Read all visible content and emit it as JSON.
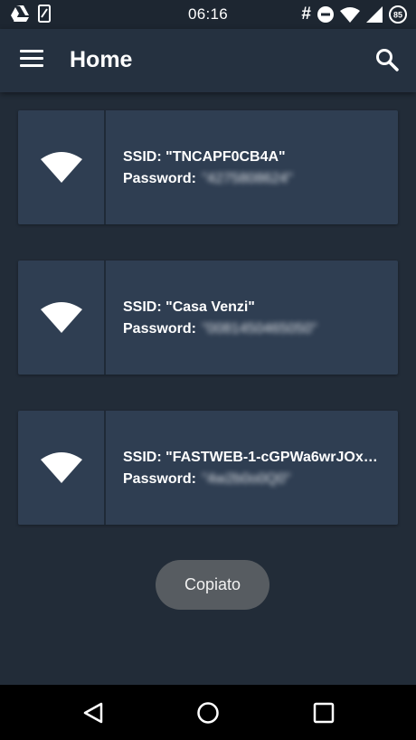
{
  "status_bar": {
    "time": "06:16",
    "left_icons": [
      "drive-icon",
      "phone-icon"
    ],
    "right_icons": [
      "hash-icon",
      "dnd-icon",
      "wifi-icon",
      "signal-icon",
      "battery-icon"
    ],
    "hash_symbol": "#",
    "battery_level": "85"
  },
  "app_bar": {
    "title": "Home",
    "menu_icon": "menu-icon",
    "search_icon": "search-icon"
  },
  "networks": [
    {
      "ssid_label": "SSID: \"TNCAPF0CB4A\"",
      "password_prefix": "Password:",
      "password_hidden": "\"4275808624\""
    },
    {
      "ssid_label": "SSID: \"Casa Venzi\"",
      "password_prefix": "Password:",
      "password_hidden": "\"0081450465050\""
    },
    {
      "ssid_label": "SSID: \"FASTWEB-1-cGPWa6wrJOx…",
      "password_prefix": "Password:",
      "password_hidden": "\"4w2b0o0Q0\""
    }
  ],
  "toast": {
    "text": "Copiato"
  },
  "nav_bar": {
    "back_icon": "back-icon",
    "home_icon": "home-icon",
    "recents_icon": "recents-icon"
  }
}
